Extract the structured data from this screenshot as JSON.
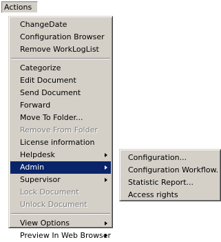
{
  "menubar": {
    "actions_label": "Actions"
  },
  "menu": {
    "items": [
      {
        "label": "ChangeDate"
      },
      {
        "label": "Configuration Browser"
      },
      {
        "label": "Remove WorkLogList"
      },
      {
        "label": "Categorize"
      },
      {
        "label": "Edit Document"
      },
      {
        "label": "Send Document"
      },
      {
        "label": "Forward"
      },
      {
        "label": "Move To Folder..."
      },
      {
        "label": "Remove From Folder",
        "enabled": false
      },
      {
        "label": "License information"
      },
      {
        "label": "Helpdesk",
        "submenu": true
      },
      {
        "label": "Admin",
        "submenu": true,
        "highlighted": true
      },
      {
        "label": "Supervisor",
        "submenu": true
      },
      {
        "label": "Lock Document",
        "enabled": false
      },
      {
        "label": "Unlock Document",
        "enabled": false
      },
      {
        "label": "View Options",
        "submenu": true
      },
      {
        "label": "Preview In Web Browser",
        "submenu": true
      }
    ]
  },
  "admin_submenu": {
    "items": [
      {
        "label": "Configuration..."
      },
      {
        "label": "Configuration Workflow..."
      },
      {
        "label": "Statistic Report..."
      },
      {
        "label": "Access rights"
      }
    ]
  },
  "colors": {
    "menu_bg": "#d4d0c8",
    "highlight": "#0a246a",
    "disabled_text": "#808080"
  }
}
